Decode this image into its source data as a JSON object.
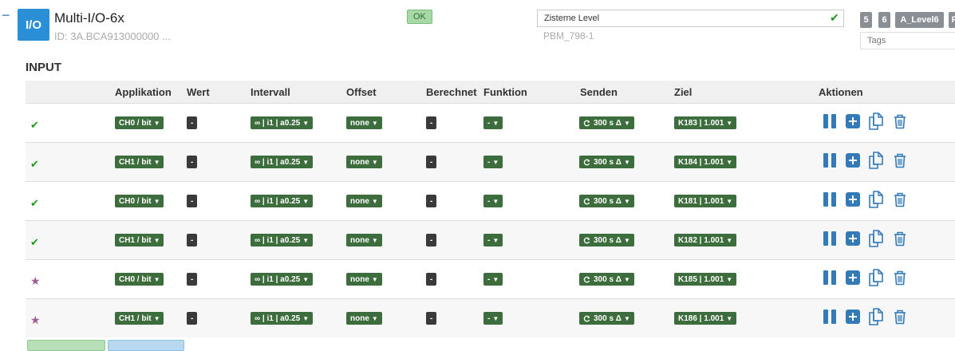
{
  "device": {
    "icon_label": "I/O",
    "collapse_symbol": "−",
    "title": "Multi-I/O-6x",
    "id_text": "ID: 3A.BCA913000000 ...",
    "status": "OK",
    "name_value": "Zisterne Level",
    "subtitle": "PBM_798-1",
    "tag_badges": [
      "5",
      "6",
      "A_Level6",
      "F"
    ],
    "tags_placeholder": "Tags"
  },
  "section": {
    "title": "INPUT"
  },
  "columns": [
    "Applikation",
    "Wert",
    "Intervall",
    "Offset",
    "Berechnet",
    "Funktion",
    "Senden",
    "Ziel",
    "Aktionen"
  ],
  "rows": [
    {
      "marker": "check",
      "applikation": "CH0 / bit",
      "wert": "-",
      "intervall": "∞ | i1 | a0.25",
      "offset": "none",
      "berechnet": "-",
      "funktion": "-",
      "senden": "300 s Δ",
      "ziel": "K183 | 1.001"
    },
    {
      "marker": "check",
      "applikation": "CH1 / bit",
      "wert": "-",
      "intervall": "∞ | i1 | a0.25",
      "offset": "none",
      "berechnet": "-",
      "funktion": "-",
      "senden": "300 s Δ",
      "ziel": "K184 | 1.001"
    },
    {
      "marker": "check",
      "applikation": "CH0 / bit",
      "wert": "-",
      "intervall": "∞ | i1 | a0.25",
      "offset": "none",
      "berechnet": "-",
      "funktion": "-",
      "senden": "300 s Δ",
      "ziel": "K181 | 1.001"
    },
    {
      "marker": "check",
      "applikation": "CH1 / bit",
      "wert": "-",
      "intervall": "∞ | i1 | a0.25",
      "offset": "none",
      "berechnet": "-",
      "funktion": "-",
      "senden": "300 s Δ",
      "ziel": "K182 | 1.001"
    },
    {
      "marker": "star",
      "applikation": "CH0 / bit",
      "wert": "-",
      "intervall": "∞ | i1 | a0.25",
      "offset": "none",
      "berechnet": "-",
      "funktion": "-",
      "senden": "300 s Δ",
      "ziel": "K185 | 1.001"
    },
    {
      "marker": "star",
      "applikation": "CH1 / bit",
      "wert": "-",
      "intervall": "∞ | i1 | a0.25",
      "offset": "none",
      "berechnet": "-",
      "funktion": "-",
      "senden": "300 s Δ",
      "ziel": "K186 | 1.001"
    }
  ],
  "colors": {
    "accent": "#337ab7",
    "device_icon": "#2a8fd6",
    "chip_green": "#3d6d3d",
    "chip_dark": "#3a3a3a",
    "check": "#1a9b1a",
    "star": "#a25a96",
    "badge_gray": "#8a8f96"
  },
  "icons": {
    "row_actions": [
      "pause-icon",
      "plus-square-icon",
      "copy-icon",
      "trash-icon"
    ],
    "marker_check": "check-icon",
    "marker_star": "star-icon",
    "senden": "refresh-icon"
  }
}
